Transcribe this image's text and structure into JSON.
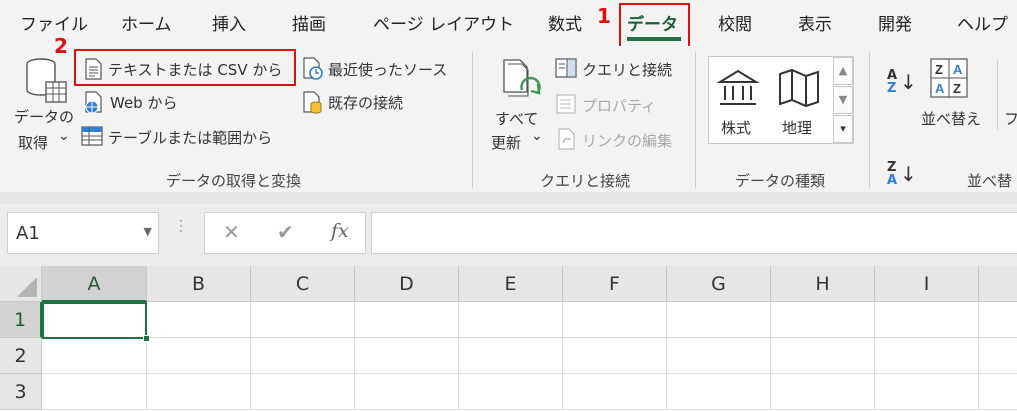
{
  "tabs": [
    {
      "label": "ファイル"
    },
    {
      "label": "ホーム"
    },
    {
      "label": "挿入"
    },
    {
      "label": "描画"
    },
    {
      "label": "ページ レイアウト"
    },
    {
      "label": "数式"
    },
    {
      "label": "データ"
    },
    {
      "label": "校閲"
    },
    {
      "label": "表示"
    },
    {
      "label": "開発"
    },
    {
      "label": "ヘルプ"
    }
  ],
  "annotations": {
    "step1": "1",
    "step2": "2"
  },
  "ribbon": {
    "get_data": {
      "line1": "データの",
      "line2": "取得",
      "chevron": "⌄"
    },
    "from_text_csv": "テキストまたは CSV から",
    "from_web": "Web から",
    "from_table_range": "テーブルまたは範囲から",
    "recent_sources": "最近使ったソース",
    "existing_connections": "既存の接続",
    "group_get_transform": "データの取得と変換",
    "refresh_all": {
      "line1": "すべて",
      "line2": "更新",
      "chevron": "⌄"
    },
    "queries_connections": "クエリと接続",
    "properties": "プロパティ",
    "edit_links": "リンクの編集",
    "group_queries": "クエリと接続",
    "data_types": {
      "stocks": "株式",
      "geography": "地理"
    },
    "group_data_types": "データの種類",
    "sort": "並べ替え",
    "sort_az": {
      "top": "A",
      "bottom": "Z"
    },
    "sort_za": {
      "top": "Z",
      "bottom": "A"
    },
    "filter_partial": "フ",
    "group_sort_partial": "並べ替"
  },
  "formula_bar": {
    "name_box": "A1",
    "cancel": "✕",
    "enter": "✔",
    "fx": "fx",
    "formula": ""
  },
  "grid": {
    "columns": [
      "A",
      "B",
      "C",
      "D",
      "E",
      "F",
      "G",
      "H",
      "I"
    ],
    "rows": [
      "1",
      "2",
      "3"
    ]
  },
  "colors": {
    "accent": "#217346",
    "highlight": "#e01010"
  }
}
